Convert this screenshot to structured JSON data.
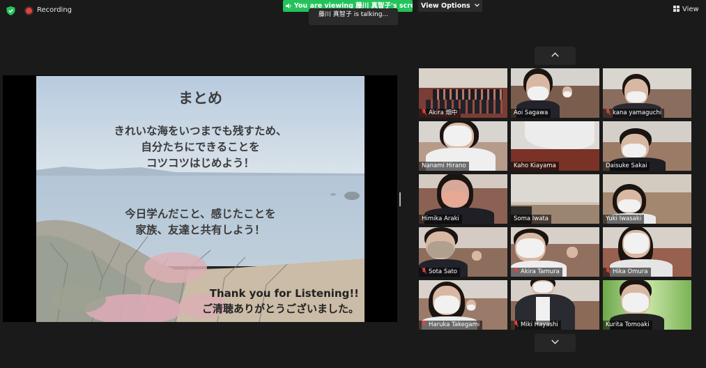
{
  "topbar": {
    "recording_label": "Recording",
    "viewing_banner": "You are viewing 藤川 真智子's screen",
    "view_options_label": "View Options",
    "talking_label": "藤川 真智子 is talking...",
    "view_label": "View"
  },
  "slide": {
    "title": "まとめ",
    "block1": [
      "きれいな海をいつまでも残すため、",
      "自分たちにできることを",
      "コツコツはじめよう！"
    ],
    "block2": [
      "今日学んだこと、感じたことを",
      "家族、友達と共有しよう！"
    ],
    "thanks": [
      "Thank you for Listening!!",
      "ご清聴ありがとうございました。"
    ]
  },
  "participants": [
    {
      "name": "Akira 畑中",
      "muted": true
    },
    {
      "name": "Aoi Sagawa",
      "muted": false
    },
    {
      "name": "kana yamaguchi",
      "muted": true
    },
    {
      "name": "Nanami Hirano",
      "muted": false
    },
    {
      "name": "Kaho Kiayama",
      "muted": false
    },
    {
      "name": "Daisuke Sakai",
      "muted": false
    },
    {
      "name": "Himika Araki",
      "muted": false
    },
    {
      "name": "Soma Iwata",
      "muted": false
    },
    {
      "name": "Yuki Iwasaki",
      "muted": false
    },
    {
      "name": "Sota Sato",
      "muted": true
    },
    {
      "name": "Akira Tamura",
      "muted": true
    },
    {
      "name": "Hika Omura",
      "muted": true
    },
    {
      "name": "Haruka Takegami",
      "muted": true
    },
    {
      "name": "Miki Hayashi",
      "muted": true
    },
    {
      "name": "Kurita Tomoaki",
      "muted": false
    }
  ],
  "colors": {
    "background": "#1a1a1a",
    "banner_green": "#23c35b",
    "recording_red": "#e0443e",
    "mute_red": "#e0443e"
  }
}
